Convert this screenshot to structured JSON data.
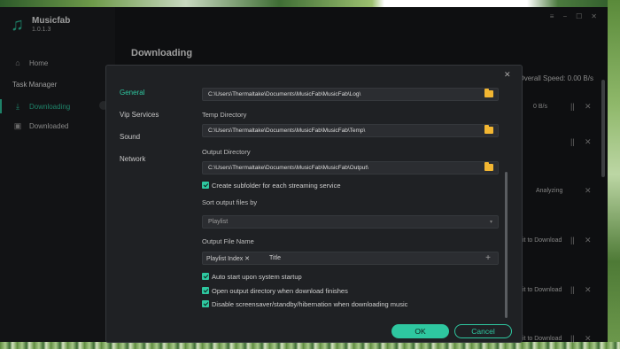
{
  "app": {
    "name": "Musicfab",
    "version": "1.0.1.3",
    "page_title": "Downloading",
    "section_label": "Task Manager",
    "overall_speed_label": "Overall Speed:",
    "overall_speed_value": "0.00 B/s",
    "window_controls": [
      "≡",
      "−",
      "☐",
      "✕"
    ]
  },
  "sidebar": {
    "items": [
      {
        "label": "Home",
        "icon": "home-icon"
      },
      {
        "label": "Downloading",
        "icon": "download-icon"
      },
      {
        "label": "Downloaded",
        "icon": "downloaded-icon"
      }
    ]
  },
  "downloads": {
    "rows": [
      {
        "status": "0 B/s",
        "pause": "||",
        "close": "✕"
      },
      {
        "status": "",
        "pause": "||",
        "close": "✕"
      },
      {
        "status": "Analyzing",
        "pause": "",
        "close": "✕"
      },
      {
        "status": "it to Download",
        "pause": "||",
        "close": "✕"
      },
      {
        "status": "it to Download",
        "pause": "||",
        "close": "✕"
      },
      {
        "status": "it to Download",
        "pause": "||",
        "close": "✕"
      }
    ]
  },
  "dialog": {
    "close_glyph": "✕",
    "tabs": [
      "General",
      "Vip Services",
      "Sound",
      "Network"
    ],
    "log_dir_path": "C:\\Users\\Thermaltake\\Documents\\MusicFab\\MusicFab\\Log\\",
    "temp_dir_label": "Temp Directory",
    "temp_dir_path": "C:\\Users\\Thermaltake\\Documents\\MusicFab\\MusicFab\\Temp\\",
    "output_dir_label": "Output Directory",
    "output_dir_path": "C:\\Users\\Thermaltake\\Documents\\MusicFab\\MusicFab\\Output\\",
    "subfolder_label": "Create subfolder for each streaming service",
    "sort_label": "Sort output files by",
    "sort_value": "Playlist",
    "sort_arrow": "▾",
    "file_name_label": "Output File Name",
    "file_name_tags": [
      "Playlist Index ✕",
      "Title"
    ],
    "add_glyph": "+",
    "options": [
      "Auto start upon system startup",
      "Open output directory when download finishes",
      "Disable screensaver/standby/hibernation when downloading music"
    ],
    "ok_label": "OK",
    "cancel_label": "Cancel"
  },
  "colors": {
    "accent": "#2ec7a0",
    "folder": "#f2b632"
  }
}
